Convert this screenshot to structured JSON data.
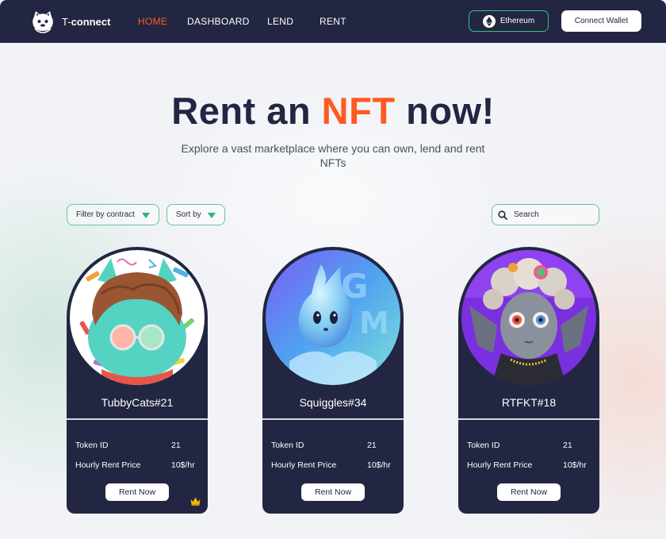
{
  "brand": {
    "name_prefix": "T-",
    "name_bold": "connect"
  },
  "nav": {
    "items": [
      {
        "label": "HOME",
        "active": true
      },
      {
        "label": "DASHBOARD",
        "active": false
      },
      {
        "label": "LEND",
        "active": false
      },
      {
        "label": "RENT",
        "active": false
      }
    ],
    "network_label": "Ethereum",
    "connect_label": "Connect Wallet"
  },
  "hero": {
    "title_start": "Rent an ",
    "title_accent": "NFT",
    "title_end": " now!",
    "subtitle": "Explore a vast marketplace where you can own, lend and rent NFTs"
  },
  "filters": {
    "contract_label": "Filter by contract",
    "sort_label": "Sort by",
    "search_placeholder": "Search"
  },
  "cards": [
    {
      "name": "TubbyCats#21",
      "token_id_label": "Token ID",
      "token_id": "21",
      "price_label": "Hourly Rent Price",
      "price": "10$/hr",
      "cta": "Rent Now",
      "featured": true
    },
    {
      "name": "Squiggles#34",
      "token_id_label": "Token ID",
      "token_id": "21",
      "price_label": "Hourly Rent Price",
      "price": "10$/hr",
      "cta": "Rent Now",
      "featured": false
    },
    {
      "name": "RTFKT#18",
      "token_id_label": "Token ID",
      "token_id": "21",
      "price_label": "Hourly Rent Price",
      "price": "10$/hr",
      "cta": "Rent Now",
      "featured": false
    }
  ],
  "colors": {
    "navy": "#222642",
    "accent": "#ff5a1f",
    "green": "#3fbf80",
    "crown": "#f5b800"
  },
  "icons": [
    "cat-logo-icon",
    "ethereum-icon",
    "chevron-down-icon",
    "search-icon",
    "crown-icon"
  ]
}
